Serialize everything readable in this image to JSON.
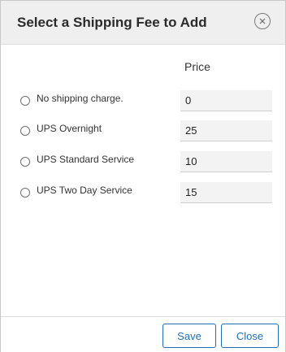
{
  "dialog": {
    "title": "Select a Shipping Fee to Add",
    "close_icon": "close-circle-icon"
  },
  "table": {
    "price_header": "Price",
    "rows": [
      {
        "label": "No shipping charge.",
        "price": "0",
        "selected": false
      },
      {
        "label": "UPS Overnight",
        "price": "25",
        "selected": false
      },
      {
        "label": "UPS Standard Service",
        "price": "10",
        "selected": false
      },
      {
        "label": "UPS Two Day Service",
        "price": "15",
        "selected": false
      }
    ]
  },
  "footer": {
    "save_label": "Save",
    "close_label": "Close"
  },
  "colors": {
    "header_bg": "#efefef",
    "accent": "#1f6fb5",
    "input_bg": "#f3f3f3"
  }
}
